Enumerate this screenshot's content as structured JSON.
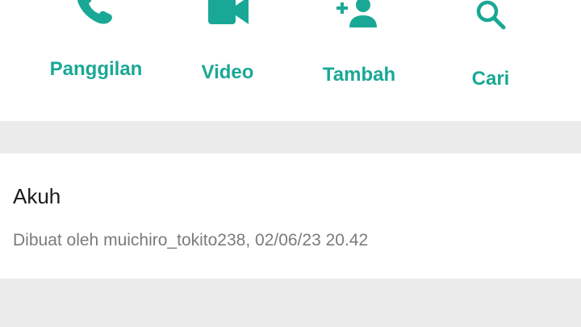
{
  "actions": [
    {
      "label": "Panggilan",
      "icon": "phone-icon"
    },
    {
      "label": "Video",
      "icon": "video-camera-icon"
    },
    {
      "label": "Tambah",
      "icon": "add-person-icon"
    },
    {
      "label": "Cari",
      "icon": "search-icon"
    }
  ],
  "group": {
    "title": "Akuh",
    "meta": "Dibuat oleh muichiro_tokito238, 02/06/23 20.42"
  },
  "colors": {
    "accent": "#1aa896",
    "background": "#f2f2f2",
    "card": "#ffffff"
  }
}
